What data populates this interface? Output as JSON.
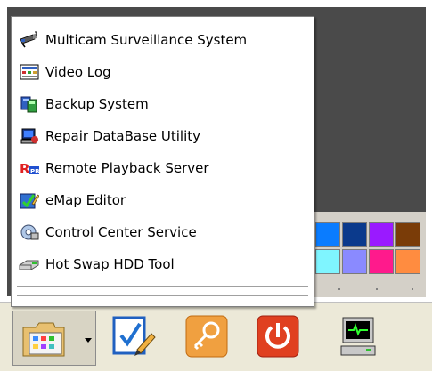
{
  "menu": {
    "items": [
      {
        "label": "Multicam Surveillance System",
        "icon": "surveillance-camera-icon"
      },
      {
        "label": "Video Log",
        "icon": "video-log-icon"
      },
      {
        "label": "Backup System",
        "icon": "backup-icon"
      },
      {
        "label": "Repair DataBase Utility",
        "icon": "repair-database-icon"
      },
      {
        "label": "Remote Playback Server",
        "icon": "remote-playback-icon"
      },
      {
        "label": "eMap Editor",
        "icon": "emap-editor-icon"
      },
      {
        "label": "Control Center Service",
        "icon": "control-center-icon"
      },
      {
        "label": "Hot Swap HDD Tool",
        "icon": "hdd-tool-icon"
      }
    ]
  },
  "toolbar": {
    "buttons": [
      {
        "icon": "app-launcher-icon"
      },
      {
        "icon": "checklist-edit-icon"
      },
      {
        "icon": "key-icon"
      },
      {
        "icon": "power-icon"
      },
      {
        "icon": "monitor-icon"
      }
    ]
  },
  "palette": {
    "colors": [
      "#0a7cff",
      "#0b3a8c",
      "#9a1aff",
      "#7a3c08",
      "#7ff5ff",
      "#8a8aff",
      "#ff1a8c",
      "#ff8c40"
    ]
  }
}
